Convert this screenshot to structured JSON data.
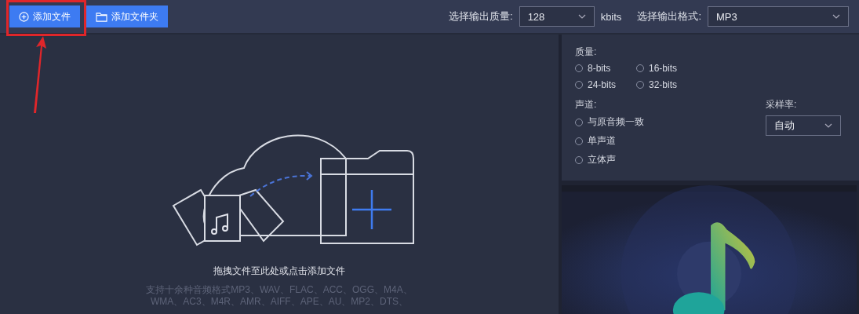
{
  "toolbar": {
    "add_file_button": "添加文件",
    "add_folder_button": "添加文件夹",
    "quality_label": "选择输出质量:",
    "quality_value": "128",
    "quality_unit": "kbits",
    "format_label": "选择输出格式:",
    "format_value": "MP3"
  },
  "annotation": {
    "kind": "highlight-arrow"
  },
  "drop_zone": {
    "hint": "拖拽文件至此处或点击添加文件",
    "formats": [
      "支持十余种音频格式MP3、WAV、FLAC、ACC、OGG、M4A、",
      "WMA、AC3、M4R、AMR、AIFF、APE、AU、MP2、DTS、"
    ]
  },
  "settings": {
    "quality_label": "质量:",
    "quality_options": [
      {
        "label": "8-bits",
        "selected": false
      },
      {
        "label": "16-bits",
        "selected": false
      },
      {
        "label": "24-bits",
        "selected": false
      },
      {
        "label": "32-bits",
        "selected": false
      }
    ],
    "channel_label": "声道:",
    "channel_options": [
      {
        "label": "与原音频一致",
        "selected": false
      },
      {
        "label": "单声道",
        "selected": false
      },
      {
        "label": "立体声",
        "selected": false
      }
    ],
    "sample_rate_label": "采样率:",
    "sample_rate_value": "自动"
  }
}
